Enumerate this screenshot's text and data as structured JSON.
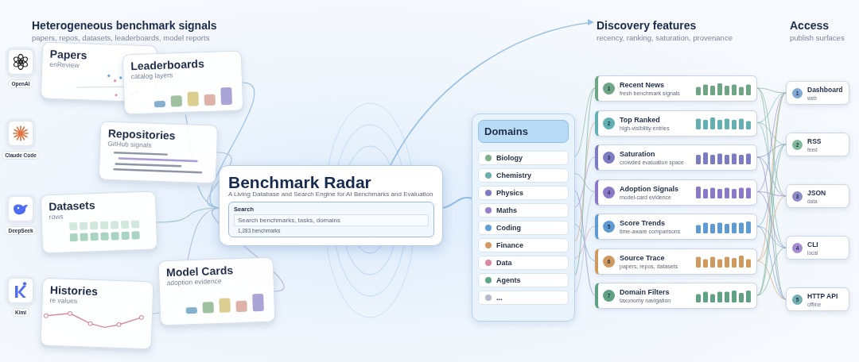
{
  "sources": {
    "title": "Heterogeneous benchmark signals",
    "subtitle": "papers, repos, datasets, leaderboards, model reports",
    "cards": [
      {
        "kind": "scatter",
        "title": "Papers",
        "subtitle": "enReview"
      },
      {
        "kind": "bars",
        "title": "Leaderboards",
        "subtitle": "catalog layers"
      },
      {
        "kind": "lines",
        "title": "Repositories",
        "subtitle": "GitHub signals"
      },
      {
        "kind": "tiles",
        "title": "Datasets",
        "subtitle": "rows"
      },
      {
        "kind": "bars",
        "title": "Model Cards",
        "subtitle": "adoption evidence"
      },
      {
        "kind": "line",
        "title": "Histories",
        "subtitle": "re values"
      }
    ],
    "logos": [
      {
        "kind": "knot",
        "label": "OpenAI"
      },
      {
        "kind": "burst",
        "label": "Claude Code"
      },
      {
        "kind": "whale",
        "label": "DeepSeek"
      },
      {
        "kind": "letter",
        "label": "Kimi"
      }
    ]
  },
  "hero": {
    "title": "Benchmark Radar",
    "subtitle": "A Living Database and Search Engine for AI Benchmarks and Evaluation",
    "search": {
      "label": "Search",
      "placeholder": "Search benchmarks, tasks, domains",
      "count": "1,283 benchmarks"
    }
  },
  "domains": {
    "title": "Domains",
    "items": [
      {
        "label": "Biology",
        "color": "#7fae8a"
      },
      {
        "label": "Chemistry",
        "color": "#6aaeb0"
      },
      {
        "label": "Physics",
        "color": "#7b7dc0"
      },
      {
        "label": "Maths",
        "color": "#9a7fce"
      },
      {
        "label": "Coding",
        "color": "#5f9fd6"
      },
      {
        "label": "Finance",
        "color": "#d39a64"
      },
      {
        "label": "Data",
        "color": "#d98aa0"
      },
      {
        "label": "Agents",
        "color": "#5fa686"
      },
      {
        "label": "...",
        "color": "#b4bccd"
      }
    ]
  },
  "features": {
    "title": "Discovery features",
    "subtitle": "recency, ranking, saturation, provenance",
    "items": [
      {
        "number": "1",
        "title": "Recent News",
        "subtitle": "fresh benchmark signals",
        "color": "#6ea585"
      },
      {
        "number": "2",
        "title": "Top Ranked",
        "subtitle": "high-visibility entries",
        "color": "#63b0b3"
      },
      {
        "number": "3",
        "title": "Saturation",
        "subtitle": "crowded evaluation space",
        "color": "#7c7cc2"
      },
      {
        "number": "4",
        "title": "Adoption Signals",
        "subtitle": "model-card evidence",
        "color": "#8c78c8"
      },
      {
        "number": "5",
        "title": "Score Trends",
        "subtitle": "time-aware comparisons",
        "color": "#5e9bd3"
      },
      {
        "number": "6",
        "title": "Source Trace",
        "subtitle": "papers, repos, datasets",
        "color": "#d09a5f"
      },
      {
        "number": "7",
        "title": "Domain Filters",
        "subtitle": "taxonomy navigation",
        "color": "#5fa283"
      }
    ]
  },
  "access": {
    "title": "Access",
    "subtitle": "publish surfaces",
    "items": [
      {
        "number": "1",
        "title": "Dashboard",
        "subtitle": "web",
        "color": "#7fa8d4"
      },
      {
        "number": "2",
        "title": "RSS",
        "subtitle": "feed",
        "color": "#7fb89a"
      },
      {
        "number": "3",
        "title": "JSON",
        "subtitle": "data",
        "color": "#8c8cc8"
      },
      {
        "number": "4",
        "title": "CLI",
        "subtitle": "local",
        "color": "#a48ad0"
      },
      {
        "number": "5",
        "title": "HTTP API",
        "subtitle": "offline",
        "color": "#72b0b0"
      }
    ]
  }
}
